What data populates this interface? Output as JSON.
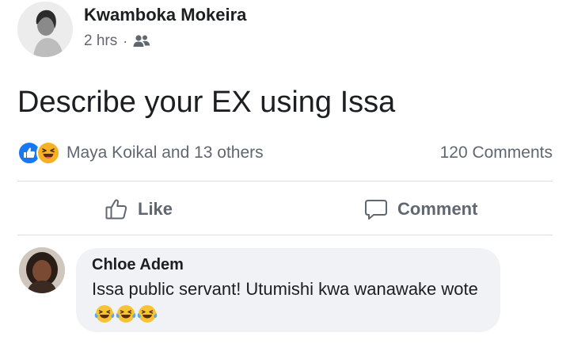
{
  "post": {
    "author": "Kwamboka Mokeira",
    "time": "2 hrs",
    "separator": "·",
    "audience_icon": "friends-icon",
    "text": "Describe your EX using Issa"
  },
  "reactions": {
    "icons": [
      "like-reaction-icon",
      "haha-reaction-icon"
    ],
    "names": "Maya Koikal and 13 others",
    "comments_count": "120 Comments"
  },
  "actions": {
    "like_label": "Like",
    "comment_label": "Comment"
  },
  "comment": {
    "author": "Chloe Adem",
    "text": "Issa public servant! Utumishi kwa wanawake wote",
    "emojis": [
      "crying-laughing-emoji",
      "crying-laughing-emoji",
      "crying-laughing-emoji"
    ]
  },
  "colors": {
    "like_blue": "#1877f2",
    "muted_text": "#606770",
    "bubble_bg": "#f0f2f5",
    "divider": "#dadde1"
  }
}
